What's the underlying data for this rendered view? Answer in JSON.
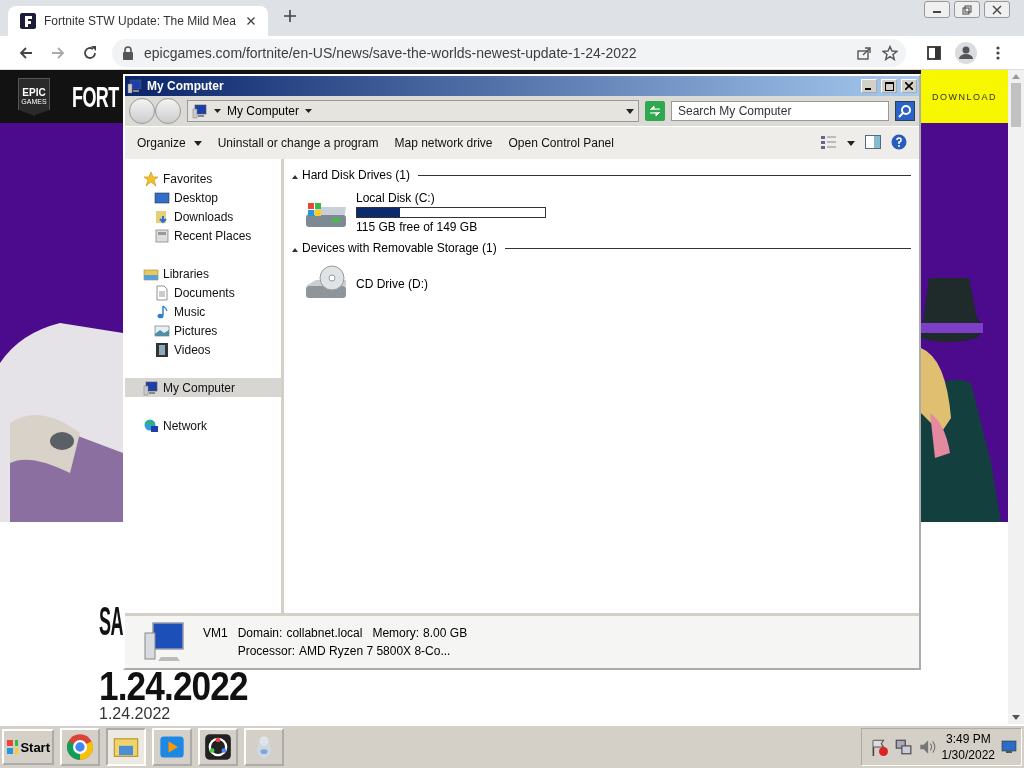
{
  "browser": {
    "tabs": [
      {
        "title": "Fortnite STW Update: The Mild Mea",
        "selected": true
      }
    ],
    "address": "epicgames.com/fortnite/en-US/news/save-the-worlds-newest-update-1-24-2022"
  },
  "page": {
    "logo": {
      "top": "EPIC",
      "bottom": "GAMES"
    },
    "brand": "FORT",
    "download": "DOWNLOAD",
    "hero": {
      "kind": "picture"
    },
    "headline": [
      "SA",
      "1.24.2022"
    ],
    "date": "1.24.2022"
  },
  "explorer": {
    "title": "My Computer",
    "breadcrumb": "My Computer",
    "search": {
      "placeholder": "Search My Computer"
    },
    "commands": [
      {
        "label": "Organize",
        "menu": true
      },
      {
        "label": "Uninstall or change a program",
        "menu": false
      },
      {
        "label": "Map network drive",
        "menu": false
      },
      {
        "label": "Open Control Panel",
        "menu": false
      }
    ],
    "nav": [
      {
        "label": "Favorites",
        "selected": false,
        "children": [
          {
            "label": "Desktop",
            "selected": false
          },
          {
            "label": "Downloads",
            "selected": false
          },
          {
            "label": "Recent Places",
            "selected": false
          }
        ]
      },
      {
        "label": "Libraries",
        "selected": false,
        "children": [
          {
            "label": "Documents",
            "selected": false
          },
          {
            "label": "Music",
            "selected": false
          },
          {
            "label": "Pictures",
            "selected": false
          },
          {
            "label": "Videos",
            "selected": false
          }
        ]
      },
      {
        "label": "My Computer",
        "selected": true
      },
      {
        "label": "Network",
        "selected": false
      }
    ],
    "groups": [
      {
        "title": "Hard Disk Drives (1)",
        "expanded": true,
        "items": [
          {
            "kind": "disk",
            "name": "Local Disk (C:)",
            "level": 0.23,
            "free": "115 GB free of 149 GB"
          }
        ]
      },
      {
        "title": "Devices with Removable Storage (1)",
        "expanded": true,
        "items": [
          {
            "kind": "cd",
            "name": "CD Drive (D:)"
          }
        ]
      }
    ],
    "details": {
      "name": "VM1",
      "fields": [
        {
          "label": "Domain:",
          "value": "collabnet.local"
        },
        {
          "label": "Memory:",
          "value": "8.00 GB"
        },
        {
          "label": "Processor:",
          "value": "AMD Ryzen 7 5800X 8-Co..."
        }
      ]
    }
  },
  "taskbar": {
    "start": "Start",
    "apps": [
      {
        "selected": false
      },
      {
        "selected": true
      },
      {
        "selected": false
      },
      {
        "selected": false
      },
      {
        "selected": false
      }
    ],
    "clock": {
      "time": "3:49 PM",
      "date": "1/30/2022"
    }
  }
}
